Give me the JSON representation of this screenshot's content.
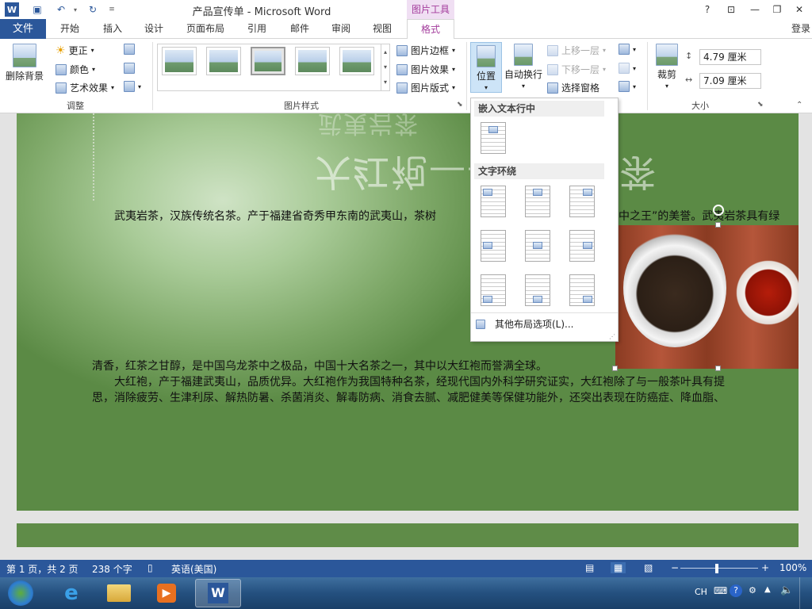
{
  "titlebar": {
    "title": "产品宣传单 - Microsoft Word",
    "context_tab": "图片工具",
    "help": "?",
    "restore_ribbon": "⊡",
    "minimize": "—",
    "maximize": "❐",
    "close": "✕",
    "qat_undo": "↶",
    "qat_redo": "↻"
  },
  "tabs": {
    "file": "文件",
    "items": [
      "开始",
      "插入",
      "设计",
      "页面布局",
      "引用",
      "邮件",
      "审阅",
      "视图"
    ],
    "format": "格式",
    "login": "登录"
  },
  "ribbon": {
    "adjust": {
      "remove_bg": "删除背景",
      "corrections": "更正",
      "color": "颜色",
      "artistic": "艺术效果",
      "label": "调整"
    },
    "styles": {
      "label": "图片样式",
      "border": "图片边框",
      "effects": "图片效果",
      "layout": "图片版式"
    },
    "arrange": {
      "position": "位置",
      "wrap": "自动换行",
      "bring_forward": "上移一层",
      "send_backward": "下移一层",
      "selection_pane": "选择窗格"
    },
    "size": {
      "crop": "裁剪",
      "height": "4.79 厘米",
      "width": "7.09 厘米",
      "label": "大小"
    }
  },
  "dropdown": {
    "inline_header": "嵌入文本行中",
    "wrap_header": "文字环绕",
    "more": "其他布局选项(L)..."
  },
  "document": {
    "line1": "武夷岩茶，汉族传统名茶。产于福建省奇秀甲东南的武夷山，茶树",
    "line1b": "中之王”的美誉。武夷岩茶具有绿",
    "line2": "清香，红茶之甘醇，是中国乌龙茶中之极品，中国十大名茶之一，其中以大红袍而誉满全球。",
    "line3": "大红袍，产于福建武夷山，品质优异。大红袍作为我国特种名茶，经现代国内外科学研究证实，大红袍除了与一般茶叶具有提",
    "line4": "思，消除疲劳、生津利尿、解热防暑、杀菌消炎、解毒防病、消食去腻、减肥健美等保健功能外，还突出表现在防癌症、降血脂、"
  },
  "status": {
    "page": "第 1 页，共 2 页",
    "words": "238 个字",
    "lang": "英语(美国)",
    "zoom": "100%"
  },
  "tray": {
    "ime": "CH"
  }
}
